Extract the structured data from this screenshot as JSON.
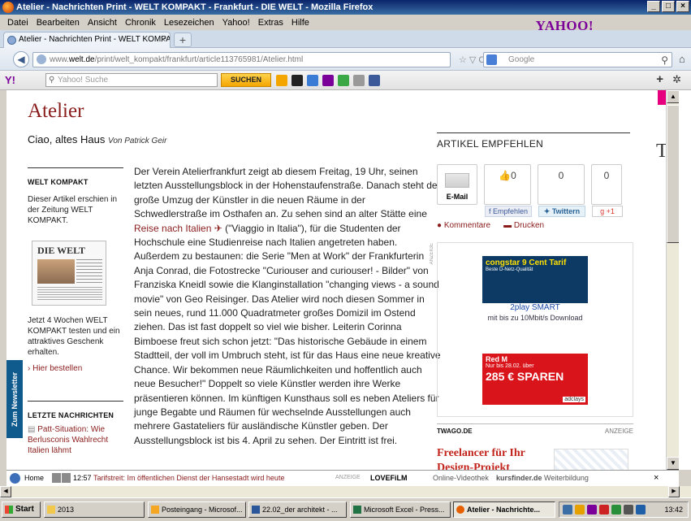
{
  "window": {
    "title": "Atelier - Nachrichten Print - WELT KOMPAKT - Frankfurt - DIE WELT - Mozilla Firefox",
    "controls": [
      "_",
      "□",
      "×"
    ]
  },
  "menubar": {
    "items": [
      "Datei",
      "Bearbeiten",
      "Ansicht",
      "Chronik",
      "Lesezeichen",
      "Yahoo!",
      "Extras",
      "Hilfe"
    ],
    "brand": "YAHOO!"
  },
  "tabs": [
    {
      "label": "Atelier - Nachrichten Print - WELT KOMPAKT ...",
      "close": "×"
    }
  ],
  "newtab_label": "+",
  "navbar": {
    "url_prefix": "www.",
    "url_domain": "welt.de",
    "url_path": "/print/welt_kompakt/frankfurt/article113765981/Atelier.html",
    "url_icons": "☆ ▽ C",
    "search_placeholder": "Google"
  },
  "ytoolbar": {
    "logo": "Y!",
    "search_placeholder": "Yahoo! Suche",
    "search_button": "SUCHEN"
  },
  "page": {
    "section_title": "Atelier",
    "headline": "Ciao, altes Haus",
    "author": "Von Patrick Geir",
    "newsletter_tab": "Zum Newsletter",
    "left_rail": {
      "heading": "WELT KOMPAKT",
      "intro": "Dieser Artikel erschien in der Zeitung WELT KOMPAKT.",
      "paper_masthead": "DIE WELT",
      "promo": "Jetzt 4 Wochen WELT KOMPAKT testen und ein attraktives Geschenk erhalten.",
      "order_link": "› Hier bestellen",
      "news_heading": "LETZTE NACHRICHTEN",
      "news_item": "Patt-Situation: Wie Berlusconis Wahlrecht Italien lähmt"
    },
    "article": {
      "p1": "Der Verein Atelierfrankfurt zeigt ab diesem Freitag, 19 Uhr, seinen letzten Ausstellungsblock in der Hohenstaufenstraße. Danach steht der große Umzug der Künstler in die neuen Räume in der Schwedlerstraße im Osthafen an. Zu sehen sind an alter Stätte eine ",
      "link": "Reise nach Italien",
      "p2": " (\"Viaggio in Italia\"), für die Studenten der Hochschule eine Studienreise nach Italien angetreten haben. Außerdem zu bestaunen: die Serie \"Men at Work\" der Frankfurterin Anja Conrad, die Fotostrecke \"Curiouser and curiouser! - Bilder\" von Franziska Kneidl sowie die Klanginstallation \"changing views - a sound movie\" von Geo Reisinger. Das Atelier wird noch diesen Sommer in sein neues, rund 11.000 Quadratmeter großes Domizil im Ostend ziehen. Das ist fast doppelt so viel wie bisher. Leiterin Corinna Bimboese freut sich schon jetzt: \"Das historische Gebäude in einem Stadtteil, der voll im Umbruch steht, ist für das Haus eine neue kreative Chance. Wir bekommen neue Räumlichkeiten und hoffentlich auch neue Besucher!\" Doppelt so viele Künstler werden ihre Werke präsentieren können. Im künftigen Kunsthaus soll es neben Ateliers für junge Begabte und Räumen für wechselnde Ausstellungen auch mehrere Gastateliers für ausländische Künstler geben. Der Ausstellungsblock ist bis 4. April zu sehen. Der Eintritt ist frei."
    },
    "share": {
      "heading": "ARTIKEL EMPFEHLEN",
      "email_label": "E-Mail",
      "fb_count": "0",
      "fb_label": "Empfehlen",
      "tw_count": "0",
      "tw_label": "Twittern",
      "gp_count": "0",
      "gp_label": "+1",
      "comments": "Kommentare",
      "print": "Drucken"
    },
    "ads": {
      "label": "ANZEIGE",
      "ad1_title": "congstar 9 Cent Tarif",
      "ad1_sub": "Beste D-Netz-Qualität",
      "ad1_b1": "2play SMART",
      "ad1_b2": "mit bis zu 10Mbit/s Download",
      "ad2_brand": "Red M",
      "ad2_sub": "Nur bis 28.02. über",
      "ad2_price": "285 € SPAREN",
      "ad2_foot": "adclays"
    },
    "twago": {
      "heading": "TWAGO.DE",
      "label": "ANZEIGE",
      "headline": "Freelancer für Ihr Design-Projekt"
    },
    "right_logo": "T"
  },
  "ticker": {
    "home": "Home",
    "time": "12:57",
    "message": "Tarifstreit: Im öffentlichen Dienst der Hansestadt wird heute",
    "ad_label": "ANZEIGE",
    "film_brand": "LOVEFiLM",
    "film_text": "Online-Videothek",
    "kurs_brand": "kursfinder.de",
    "kurs_text": "Weiterbildung",
    "close": "×"
  },
  "taskbar": {
    "start": "Start",
    "tasks": [
      {
        "label": "2013"
      },
      {
        "label": "Posteingang - Microsof..."
      },
      {
        "label": "22.02_der architekt - ..."
      },
      {
        "label": "Microsoft Excel - Press..."
      },
      {
        "label": "Atelier - Nachrichte..."
      }
    ],
    "clock": "13:42"
  },
  "colors": {
    "accent_red": "#8a1c1c",
    "yahoo_purple": "#7b0099",
    "xp_blue": "#0a246a"
  }
}
